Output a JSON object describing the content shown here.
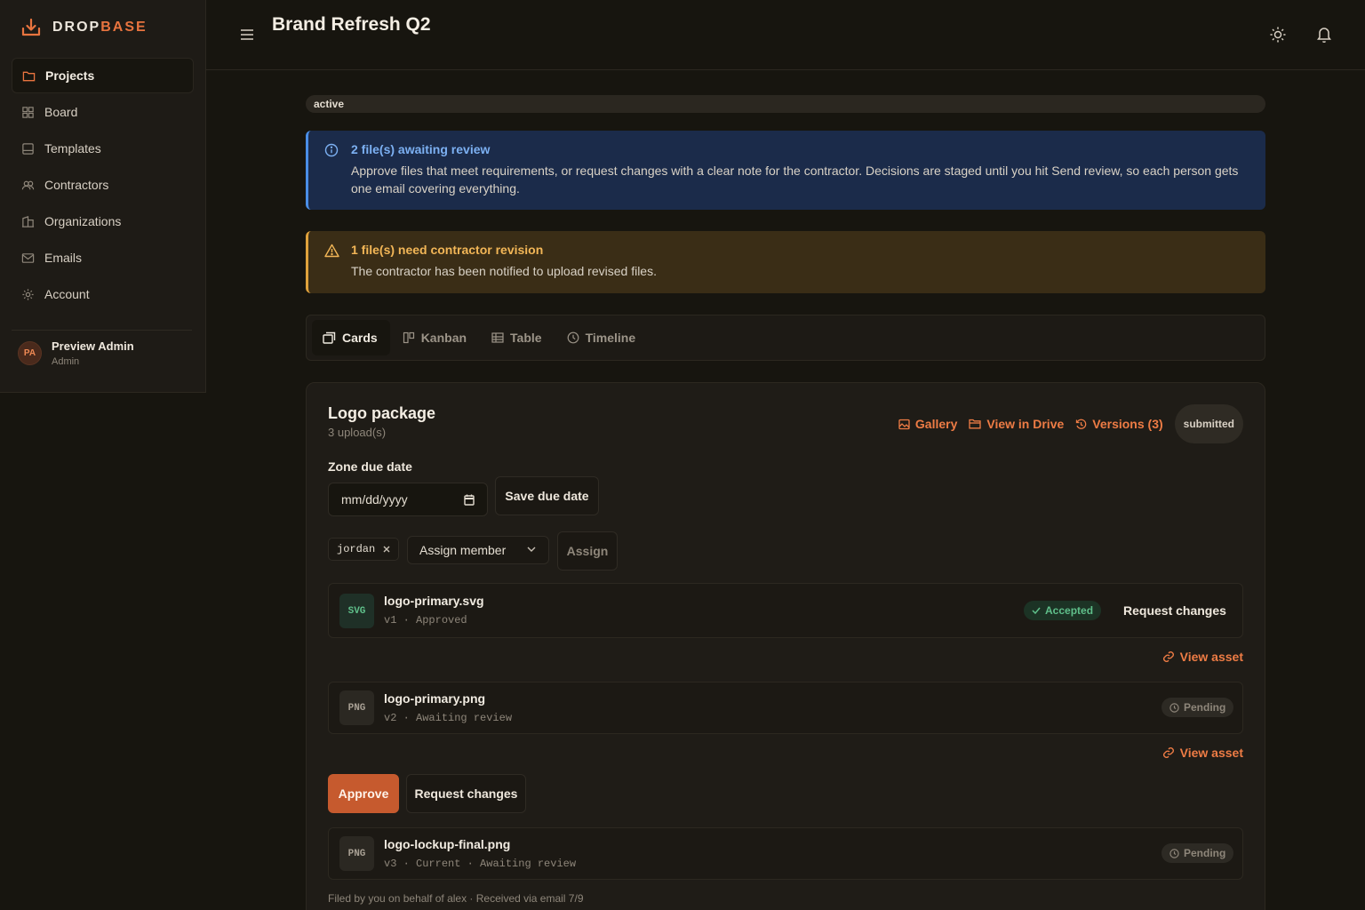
{
  "brand": {
    "part1": "DROP",
    "part2": "BASE"
  },
  "sidebar": {
    "items": [
      {
        "label": "Projects",
        "icon": "folder-icon",
        "active": true
      },
      {
        "label": "Board",
        "icon": "grid-icon"
      },
      {
        "label": "Templates",
        "icon": "template-icon"
      },
      {
        "label": "Contractors",
        "icon": "users-icon"
      },
      {
        "label": "Organizations",
        "icon": "building-icon"
      },
      {
        "label": "Emails",
        "icon": "mail-icon"
      },
      {
        "label": "Account",
        "icon": "gear-icon"
      }
    ],
    "user": {
      "initials": "PA",
      "name": "Preview Admin",
      "role": "Admin"
    }
  },
  "header": {
    "title": "Brand Refresh Q2"
  },
  "project": {
    "status": "active"
  },
  "alerts": {
    "info": {
      "title": "2 file(s) awaiting review",
      "body": "Approve files that meet requirements, or request changes with a clear note for the contractor. Decisions are staged until you hit Send review, so each person gets one email covering everything."
    },
    "warn": {
      "title": "1 file(s) need contractor revision",
      "body": "The contractor has been notified to upload revised files."
    }
  },
  "tabs": [
    {
      "label": "Cards",
      "active": true
    },
    {
      "label": "Kanban"
    },
    {
      "label": "Table"
    },
    {
      "label": "Timeline"
    }
  ],
  "zone": {
    "title": "Logo package",
    "uploads": "3 upload(s)",
    "actions": {
      "gallery": "Gallery",
      "drive": "View in Drive",
      "versions": "Versions (3)"
    },
    "status": "submitted",
    "due_label": "Zone due date",
    "due_placeholder": "mm/dd/yyyy",
    "save_due": "Save due date",
    "assignee": "jordan",
    "assign_select": "Assign member",
    "assign_button": "Assign",
    "files": [
      {
        "type": "SVG",
        "name": "logo-primary.svg",
        "version": "v1",
        "meta": "Approved",
        "status": "Accepted",
        "action": "Request changes",
        "view": "View asset"
      },
      {
        "type": "PNG",
        "name": "logo-primary.png",
        "version": "v2",
        "meta": "Awaiting review",
        "status": "Pending",
        "view": "View asset"
      },
      {
        "type": "PNG",
        "name": "logo-lockup-final.png",
        "version": "v3",
        "meta2": "Current",
        "meta": "Awaiting review",
        "status": "Pending"
      }
    ],
    "approve": "Approve",
    "request_changes": "Request changes",
    "footnote": "Filed by you on behalf of alex · Received via email 7/9"
  },
  "colors": {
    "accent": "#e8743f",
    "info": "#4a8ee6",
    "warn": "#e0a23c",
    "success": "#5fbf8a"
  }
}
